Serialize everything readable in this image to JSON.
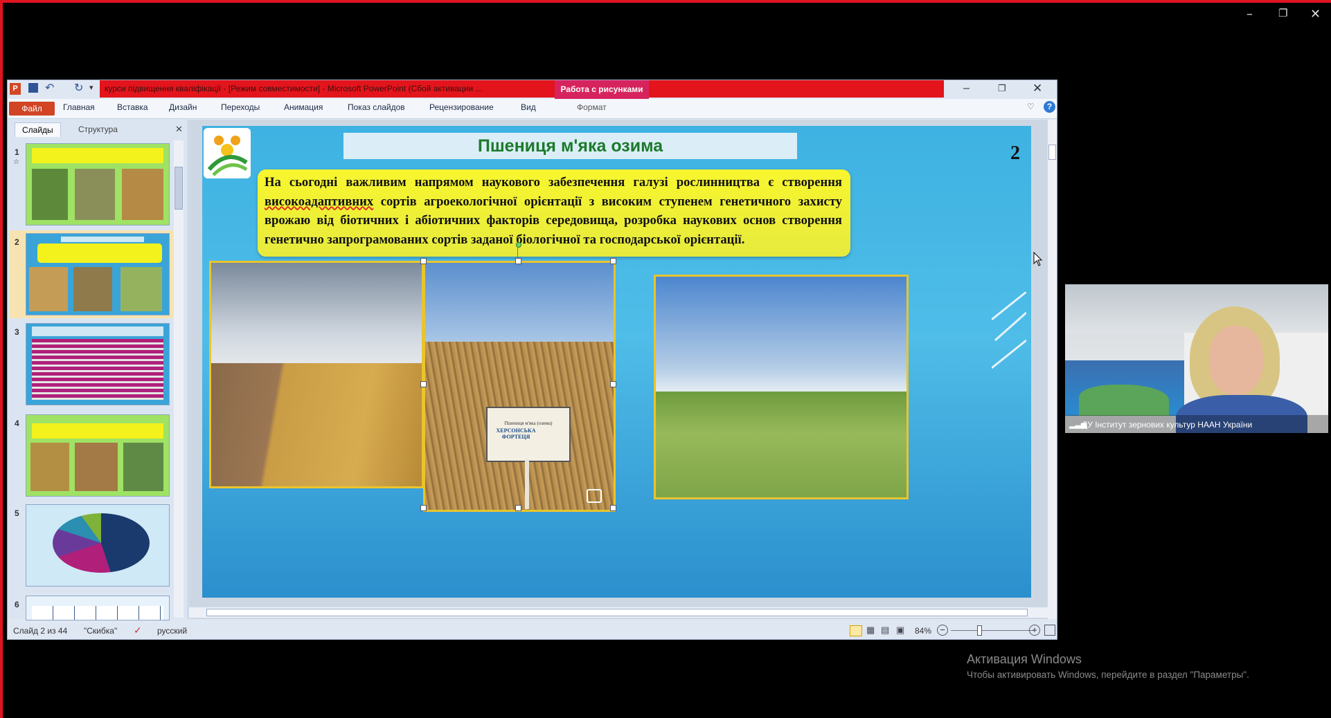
{
  "window": {
    "title": "курси підвищення кваліфікації - [Режим совместимости] - Microsoft PowerPoint (Сбой активации ...",
    "context_tab": "Работа с рисунками"
  },
  "ribbon": {
    "file": "Файл",
    "tabs": [
      "Главная",
      "Вставка",
      "Дизайн",
      "Переходы",
      "Анимация",
      "Показ слайдов",
      "Рецензирование",
      "Вид"
    ],
    "context_sub": "Формат"
  },
  "left_pane": {
    "tabs": [
      "Слайды",
      "Структура"
    ],
    "slide_numbers": [
      "1",
      "2",
      "3",
      "4",
      "5",
      "6"
    ]
  },
  "slide": {
    "title": "Пшениця м'яка озима",
    "number": "2",
    "body_prefix": "На сьогодні важливим напрямом наукового забезпечення галузі рослинництва є створення ",
    "body_underlined": "високоадаптивних",
    "body_suffix": " сортів агроекологічної орієнтації з високим ступенем генетичного захисту врожаю від біотичних і абіотичних факторів середовища, розробка наукових основ створення генетично запрограмованих сортів заданої біологічної та господарської орієнтації.",
    "sign_text": "Пшениця м'яка (озима)",
    "sign_variety": "ХЕРСОНСЬКА ФОРТЕЦЯ"
  },
  "status": {
    "slide_of": "Слайд 2 из 44",
    "theme": "\"Скибка\"",
    "language": "русский",
    "zoom": "84%"
  },
  "video": {
    "participant": "ДУ Інститут зернових культур НААН України"
  },
  "activation": {
    "title": "Активация Windows",
    "subtitle": "Чтобы активировать Windows, перейдите в раздел \"Параметры\"."
  },
  "colors": {
    "title_red": "#e3141c",
    "file_tab": "#d14424",
    "slide_bg": "#3eb2e2",
    "textbox": "#f3f21c",
    "frame": "#e9c52c"
  }
}
